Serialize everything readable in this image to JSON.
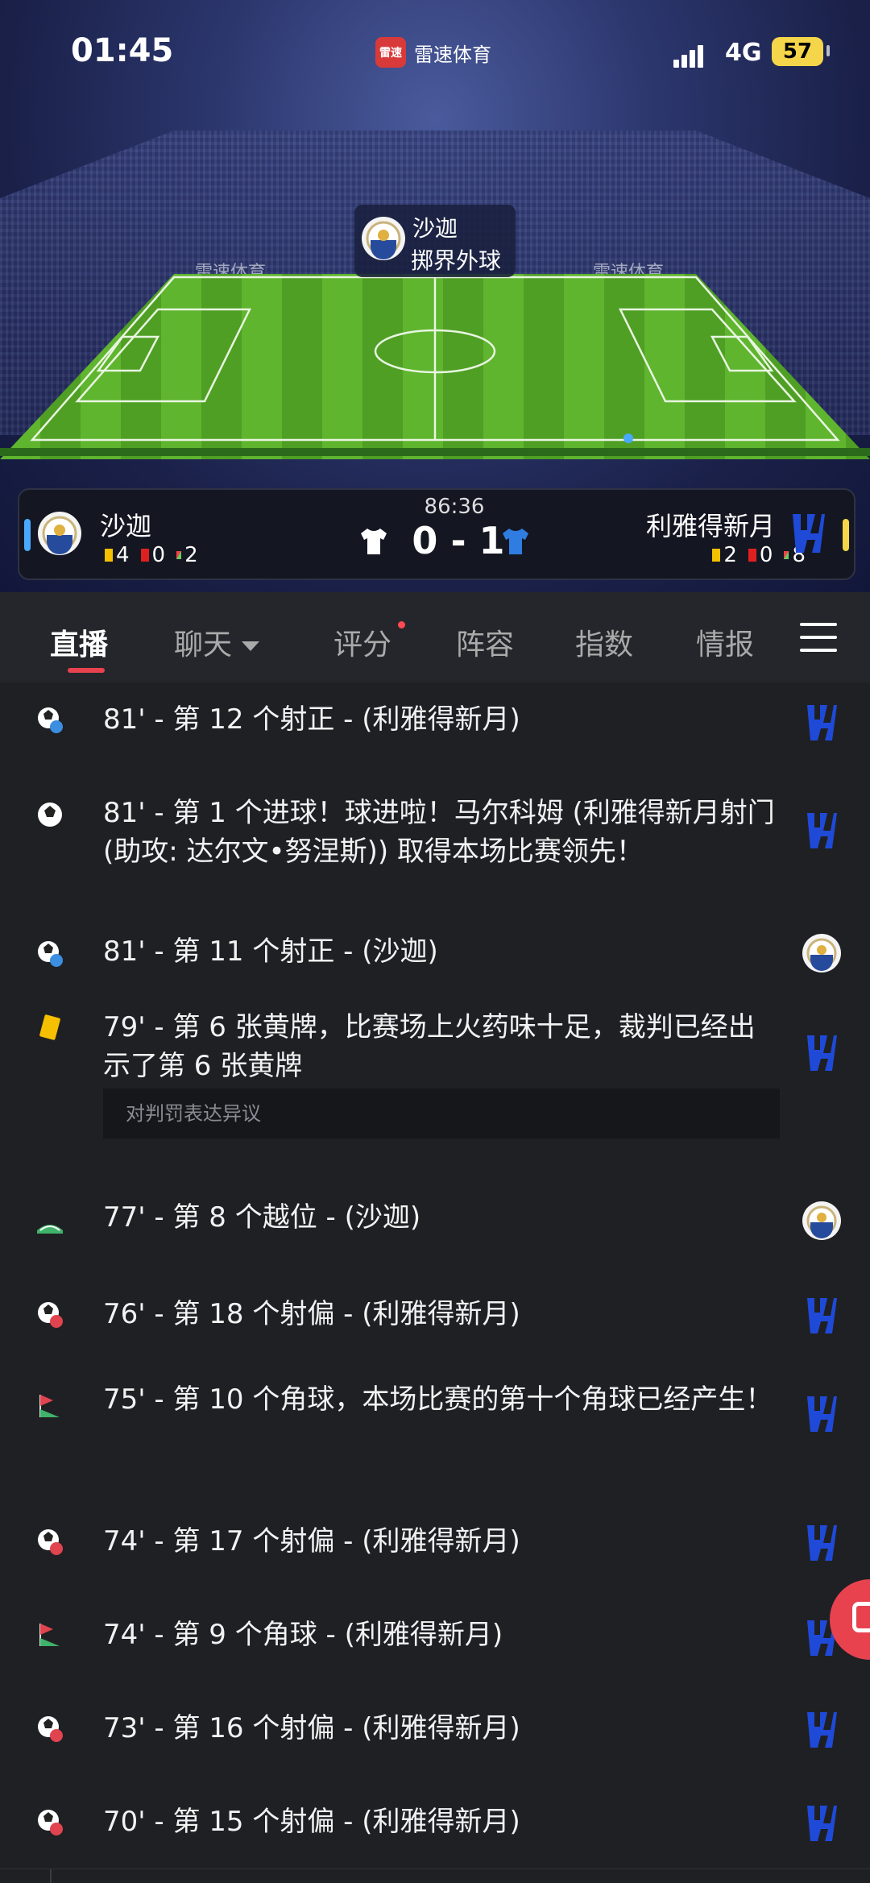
{
  "status_bar": {
    "time": "01:45",
    "app_badge": "雷速",
    "app_name": "雷速体育",
    "network": "4G",
    "battery": "57"
  },
  "pitch": {
    "sponsor_labels": [
      "雷速体育",
      "雷速体育",
      "雷速体育",
      "雷速体育"
    ],
    "possession_team": "沙迦",
    "possession_action": "掷界外球"
  },
  "scoreboard": {
    "match_time": "86:36",
    "score": "0 - 1",
    "home": {
      "name": "沙迦",
      "yellow": "4",
      "red": "0",
      "corners": "2"
    },
    "away": {
      "name": "利雅得新月",
      "yellow": "2",
      "red": "0",
      "corners": "8"
    },
    "colors": {
      "home_accent": "#49a8ff",
      "away_accent": "#f5d64a",
      "away_crest": "#1f4ad8"
    }
  },
  "tabs": [
    {
      "label": "直播",
      "active": true
    },
    {
      "label": "聊天",
      "active": false
    },
    {
      "label": "评分",
      "active": false
    },
    {
      "label": "阵容",
      "active": false
    },
    {
      "label": "指数",
      "active": false
    },
    {
      "label": "情报",
      "active": false
    }
  ],
  "events": [
    {
      "icon": "shot-on-target-icon",
      "text": "81' - 第 12 个射正 - (利雅得新月)",
      "team": "away"
    },
    {
      "icon": "goal-icon",
      "text": "81' - 第 1 个进球！球进啦！马尔科姆 (利雅得新月射门 (助攻: 达尔文•努涅斯)) 取得本场比赛领先！",
      "team": "away"
    },
    {
      "icon": "shot-on-target-icon",
      "text": "81' - 第 11 个射正 - (沙迦)",
      "team": "home"
    },
    {
      "icon": "yellow-card-icon",
      "text": "79' - 第 6 张黄牌，比赛场上火药味十足，裁判已经出示了第 6 张黄牌",
      "note": "对判罚表达异议",
      "team": "away"
    },
    {
      "icon": "offside-icon",
      "text": "77' - 第 8 个越位 - (沙迦)",
      "team": "home"
    },
    {
      "icon": "shot-off-target-icon",
      "text": "76' - 第 18 个射偏 - (利雅得新月)",
      "team": "away"
    },
    {
      "icon": "corner-flag-icon",
      "text": "75' - 第 10 个角球，本场比赛的第十个角球已经产生！",
      "team": "away"
    },
    {
      "icon": "shot-off-target-icon",
      "text": "74' - 第 17 个射偏 - (利雅得新月)",
      "team": "away"
    },
    {
      "icon": "corner-flag-icon",
      "text": "74' - 第 9 个角球 - (利雅得新月)",
      "team": "away"
    },
    {
      "icon": "shot-off-target-icon",
      "text": "73' - 第 16 个射偏 - (利雅得新月)",
      "team": "away"
    },
    {
      "icon": "shot-off-target-icon",
      "text": "70' - 第 15 个射偏 - (利雅得新月)",
      "team": "away"
    }
  ]
}
